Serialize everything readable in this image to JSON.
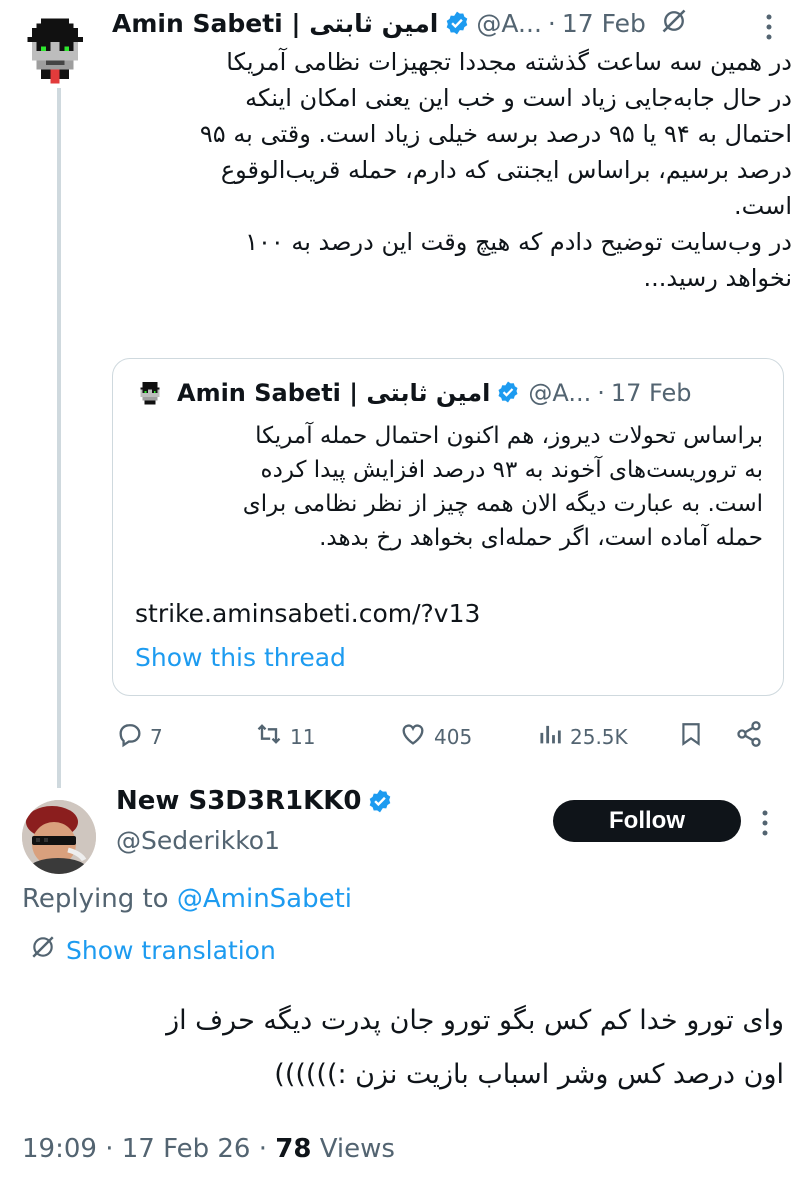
{
  "tweet": {
    "author_name": "Amin Sabeti | امین ثابتی",
    "handle": "@A...",
    "date": "17 Feb",
    "body_lines": [
      "در همین سه ساعت گذشته مجددا تجهیزات نظامی  آمریکا",
      "در حال جابه‌جایی زیاد است و خب این یعنی امکان اینکه",
      "احتمال به ۹۴ یا ۹۵ درصد برسه خیلی زیاد است. وقتی به ۹۵",
      "درصد برسیم، براساس ایجنتی که دارم، حمله قریب‌الوقوع",
      "است.",
      "در وب‌سایت توضیح دادم که هیچ وقت این درصد به ۱۰۰",
      "نخواهد رسید..."
    ],
    "quote": {
      "author_name": "Amin Sabeti | امین ثابتی",
      "handle": "@A...",
      "date": "17 Feb",
      "body_lines": [
        "براساس تحولات دیروز، هم اکنون احتمال حمله آمریکا",
        "به تروریست‌های آخوند به ۹۳ درصد افزایش پیدا کرده",
        "است. به عبارت دیگه الان همه چیز از نظر نظامی برای",
        "حمله آماده است، اگر حمله‌ای بخواهد رخ بدهد."
      ],
      "link": "strike.aminsabeti.com/?v13",
      "show_thread": "Show this thread"
    },
    "actions": {
      "replies": "7",
      "retweets": "11",
      "likes": "405",
      "views": "25.5K"
    }
  },
  "reply": {
    "author_name": "New S3D3R1KK0",
    "handle": "@Sederikko1",
    "follow_label": "Follow",
    "replying_prefix": "Replying to ",
    "replying_to": "@AminSabeti",
    "show_translation": "Show translation",
    "body_lines": [
      "وای تورو خدا کم کس بگو تورو جان پدرت دیگه حرف از",
      "اون درصد کس وشر اسباب بازیت نزن :))))))"
    ],
    "time": "19:09",
    "date": "17 Feb 26",
    "views_count": "78",
    "views_label": "Views"
  },
  "colors": {
    "accent": "#1d9bf0",
    "secondary_text": "#536471",
    "primary_text": "#0f1419",
    "border": "#cfd9de"
  }
}
